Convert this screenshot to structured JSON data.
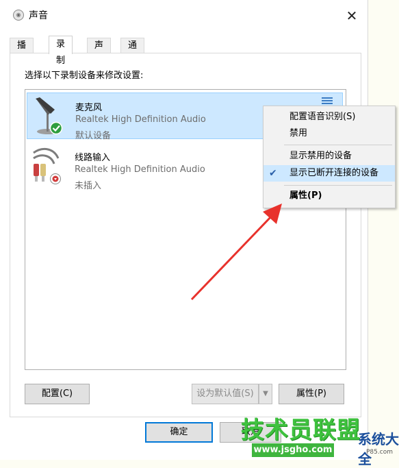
{
  "window": {
    "title": "声音",
    "close_glyph": "✕"
  },
  "tabs": [
    {
      "label": "播放",
      "active": false
    },
    {
      "label": "录制",
      "active": true
    },
    {
      "label": "声音",
      "active": false
    },
    {
      "label": "通信",
      "active": false
    }
  ],
  "instruction": "选择以下录制设备来修改设置:",
  "devices": [
    {
      "name": "麦克风",
      "driver": "Realtek High Definition Audio",
      "status": "默认设备",
      "icon": "microphone-icon",
      "badge": "default-check-badge",
      "selected": true
    },
    {
      "name": "线路输入",
      "driver": "Realtek High Definition Audio",
      "status": "未插入",
      "icon": "line-in-cable-icon",
      "badge": "unplugged-badge",
      "selected": false
    }
  ],
  "context_menu": {
    "items": [
      {
        "label": "配置语音识别(S)",
        "checked": false,
        "bold": false
      },
      {
        "label": "禁用",
        "checked": false,
        "bold": false
      },
      {
        "label": "显示禁用的设备",
        "checked": false,
        "bold": false
      },
      {
        "label": "显示已断开连接的设备",
        "checked": true,
        "bold": false
      },
      {
        "label": "属性(P)",
        "checked": false,
        "bold": true
      }
    ]
  },
  "buttons": {
    "configure": "配置(C)",
    "set_default": "设为默认值(S)",
    "properties": "属性(P)",
    "ok": "确定",
    "cancel": "取消"
  },
  "watermark": {
    "main": "技术员联盟",
    "url": "www.jsgho.com",
    "side": "系统大全",
    "small": "P85.com"
  },
  "colors": {
    "selection": "#cde8ff",
    "accent": "#0078d7",
    "annotation_arrow": "#e8322c",
    "watermark_green": "#3fc23f"
  }
}
